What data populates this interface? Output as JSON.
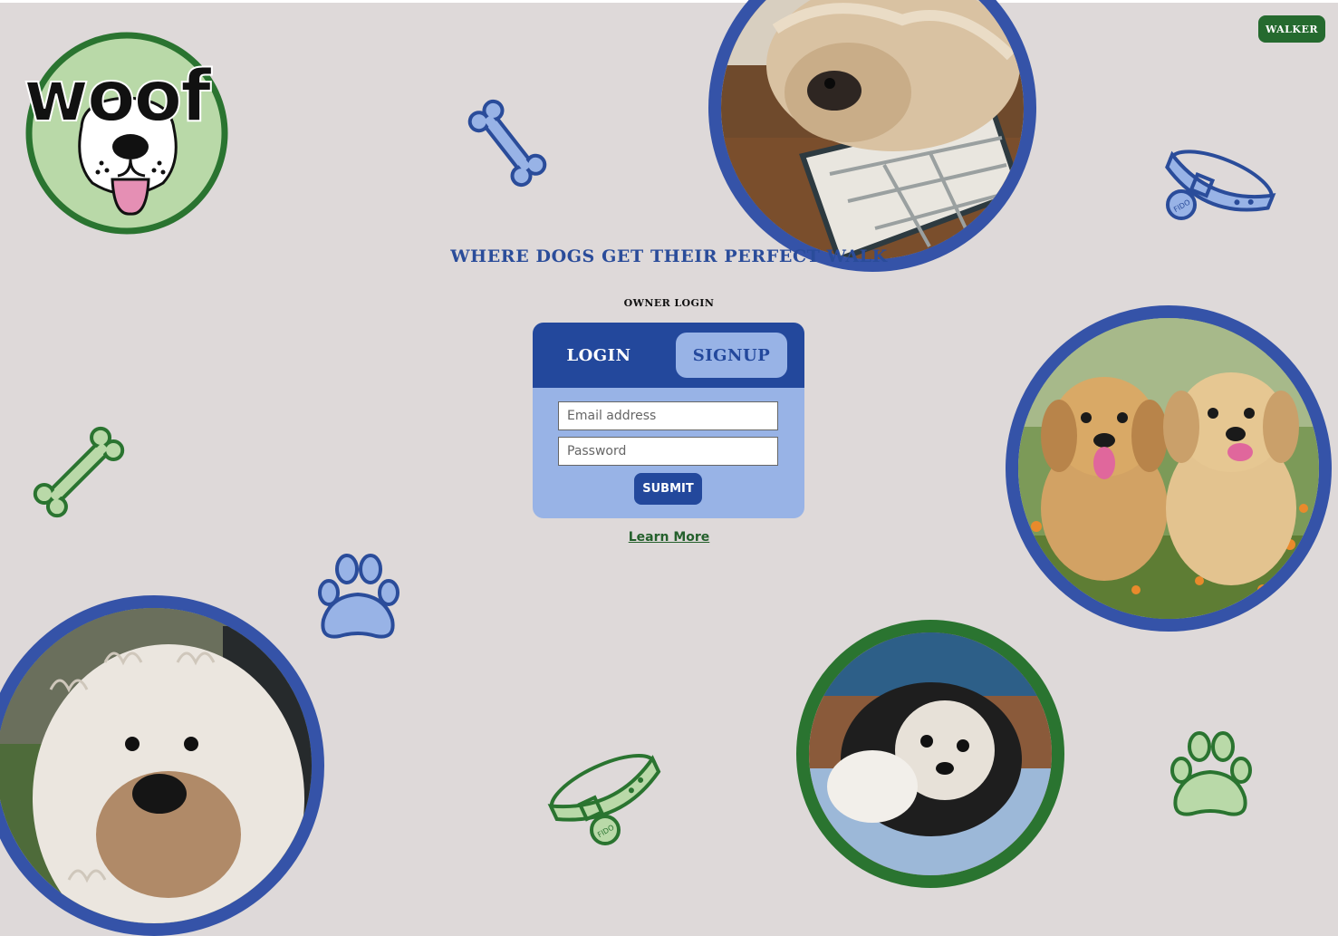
{
  "header": {
    "walker_button_label": "WALKER"
  },
  "logo": {
    "wordmark": "woof",
    "collar_tag_text": "FIDO"
  },
  "hero": {
    "tagline": "WHERE DOGS GET THEIR PERFECT WALK",
    "section_label": "OWNER LOGIN"
  },
  "auth_card": {
    "tabs": {
      "login_label": "LOGIN",
      "signup_label": "SIGNUP"
    },
    "email_placeholder": "Email address",
    "email_value": "",
    "password_placeholder": "Password",
    "password_value": "",
    "submit_label": "SUBMIT"
  },
  "footer_link": {
    "learn_more_label": "Learn More"
  },
  "colors": {
    "background": "#ded9d9",
    "brand_blue": "#23489c",
    "light_blue": "#98b3e6",
    "brand_green": "#256a2f",
    "light_green": "#b9d9a8"
  },
  "icons": [
    "bone-icon",
    "collar-icon",
    "paw-icon"
  ]
}
